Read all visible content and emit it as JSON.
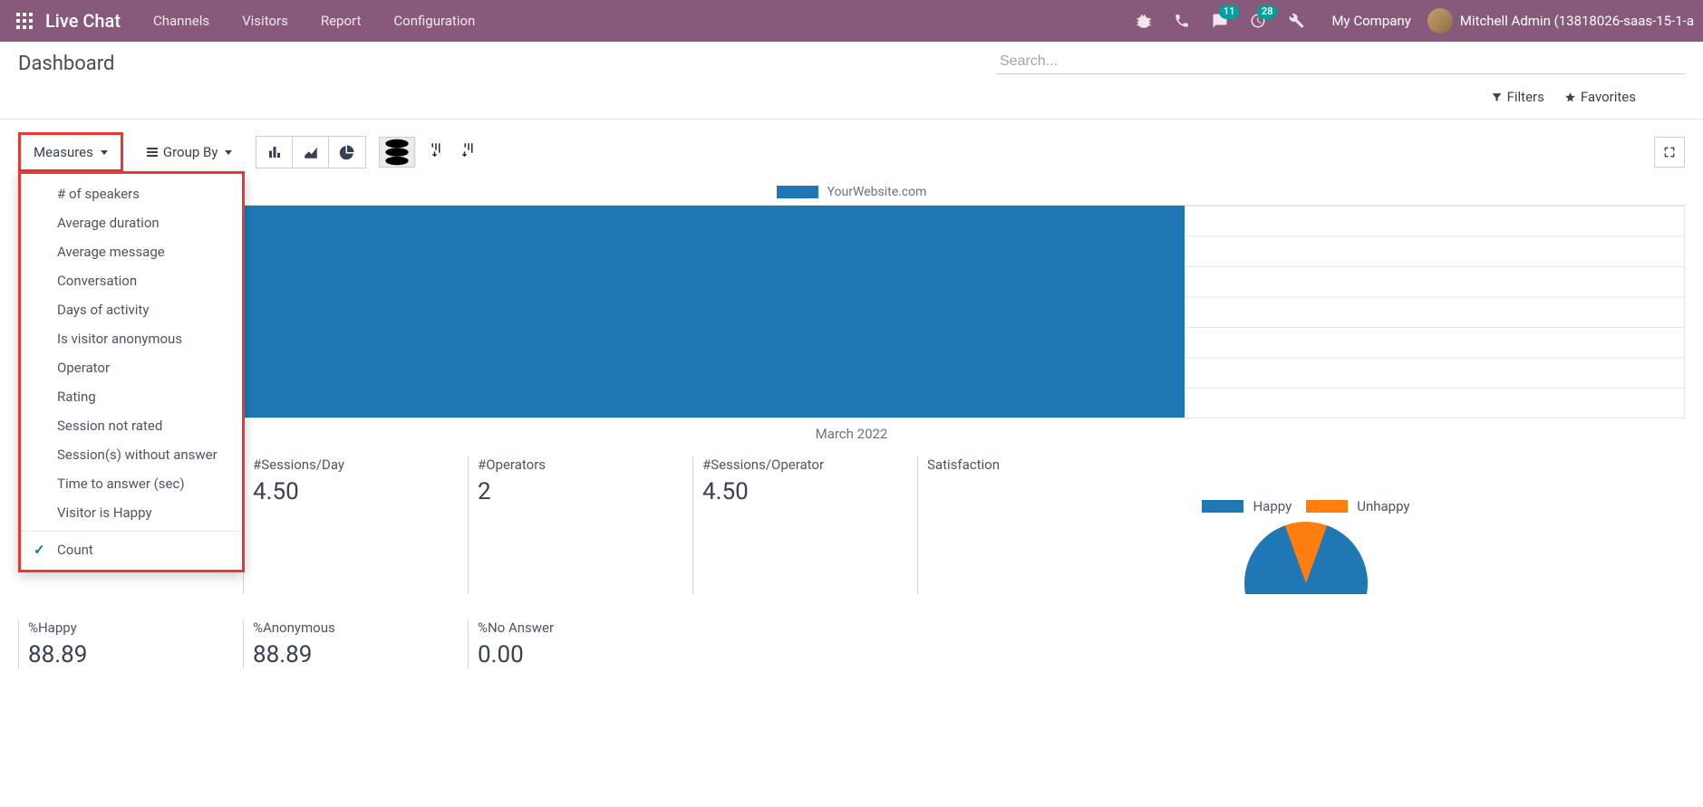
{
  "topnav": {
    "brand": "Live Chat",
    "items": [
      "Channels",
      "Visitors",
      "Report",
      "Configuration"
    ],
    "badge_messages": "11",
    "badge_activities": "28",
    "company": "My Company",
    "user": "Mitchell Admin (13818026-saas-15-1-a"
  },
  "control_panel": {
    "title": "Dashboard",
    "search_placeholder": "Search...",
    "filters": "Filters",
    "favorites": "Favorites"
  },
  "toolbar": {
    "measures": "Measures",
    "groupby": "Group By"
  },
  "measures_menu": {
    "items": [
      "# of speakers",
      "Average duration",
      "Average message",
      "Conversation",
      "Days of activity",
      "Is visitor anonymous",
      "Operator",
      "Rating",
      "Session not rated",
      "Session(s) without answer",
      "Time to answer (sec)",
      "Visitor is Happy"
    ],
    "count": "Count"
  },
  "chart_data": {
    "type": "bar",
    "legend": "YourWebsite.com",
    "categories": [
      "March 2022"
    ],
    "series": [
      {
        "name": "YourWebsite.com",
        "values": [
          9
        ],
        "color": "#1f77b4"
      }
    ],
    "x_label": "March 2022",
    "bar_fill_ratio": 0.7
  },
  "stats": {
    "row1": [
      {
        "label": "#Sessions/Day",
        "value": "4.50"
      },
      {
        "label": "#Operators",
        "value": "2"
      },
      {
        "label": "#Sessions/Operator",
        "value": "4.50"
      }
    ],
    "row2": [
      {
        "label": "%Happy",
        "value": "88.89"
      },
      {
        "label": "%Anonymous",
        "value": "88.89"
      },
      {
        "label": "%No Answer",
        "value": "0.00"
      }
    ]
  },
  "satisfaction": {
    "title": "Satisfaction",
    "legend": [
      {
        "label": "Happy",
        "color": "#1f77b4"
      },
      {
        "label": "Unhappy",
        "color": "#ff7f0e"
      }
    ],
    "pie": {
      "happy_pct": 88.89,
      "unhappy_pct": 11.11
    }
  }
}
